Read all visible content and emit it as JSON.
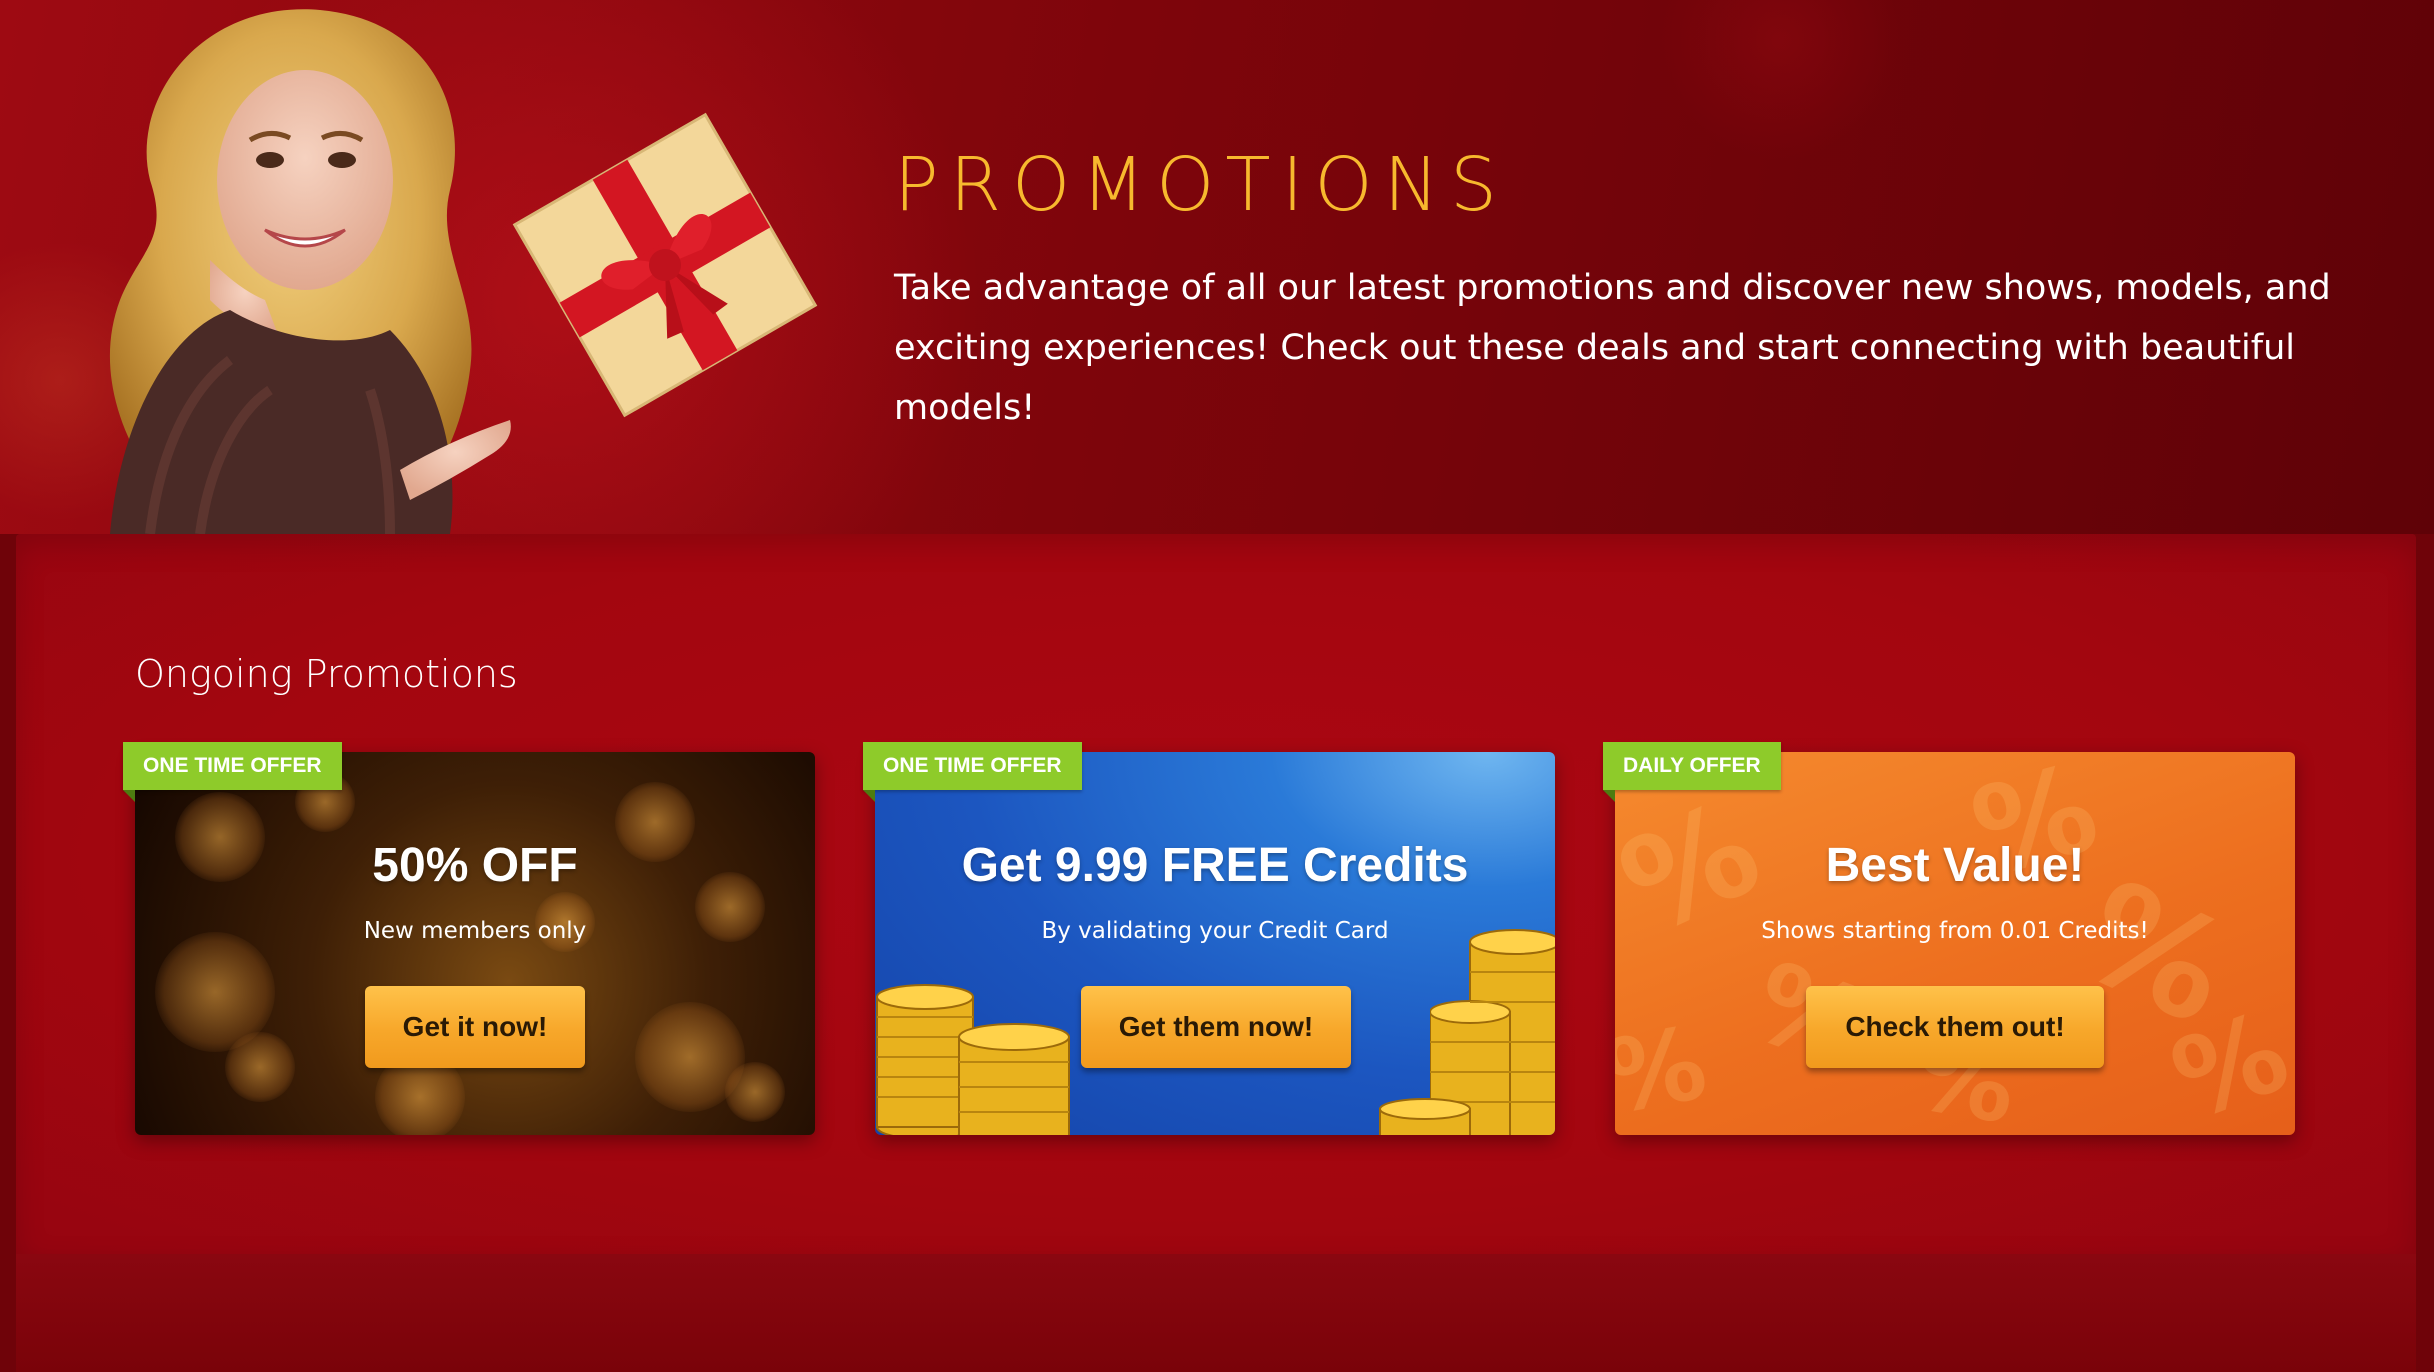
{
  "hero": {
    "title": "PROMOTIONS",
    "description": "Take advantage of all our latest promotions and discover new shows, models, and exciting experiences! Check out these deals and start connecting with beautiful models!"
  },
  "section": {
    "title": "Ongoing Promotions"
  },
  "cards": [
    {
      "badge": "ONE TIME OFFER",
      "title": "50% OFF",
      "subtitle": "New members only",
      "button": "Get it now!"
    },
    {
      "badge": "ONE TIME OFFER",
      "title": "Get 9.99 FREE Credits",
      "subtitle": "By validating your Credit Card",
      "button": "Get them now!"
    },
    {
      "badge": "DAILY OFFER",
      "title": "Best Value!",
      "subtitle": "Shows starting from 0.01 Credits!",
      "button": "Check them out!"
    }
  ],
  "colors": {
    "accent_title": "#f7b92e",
    "badge_green": "#8ecb2a",
    "button_orange": "#f7a72a",
    "page_red": "#a3060f"
  }
}
